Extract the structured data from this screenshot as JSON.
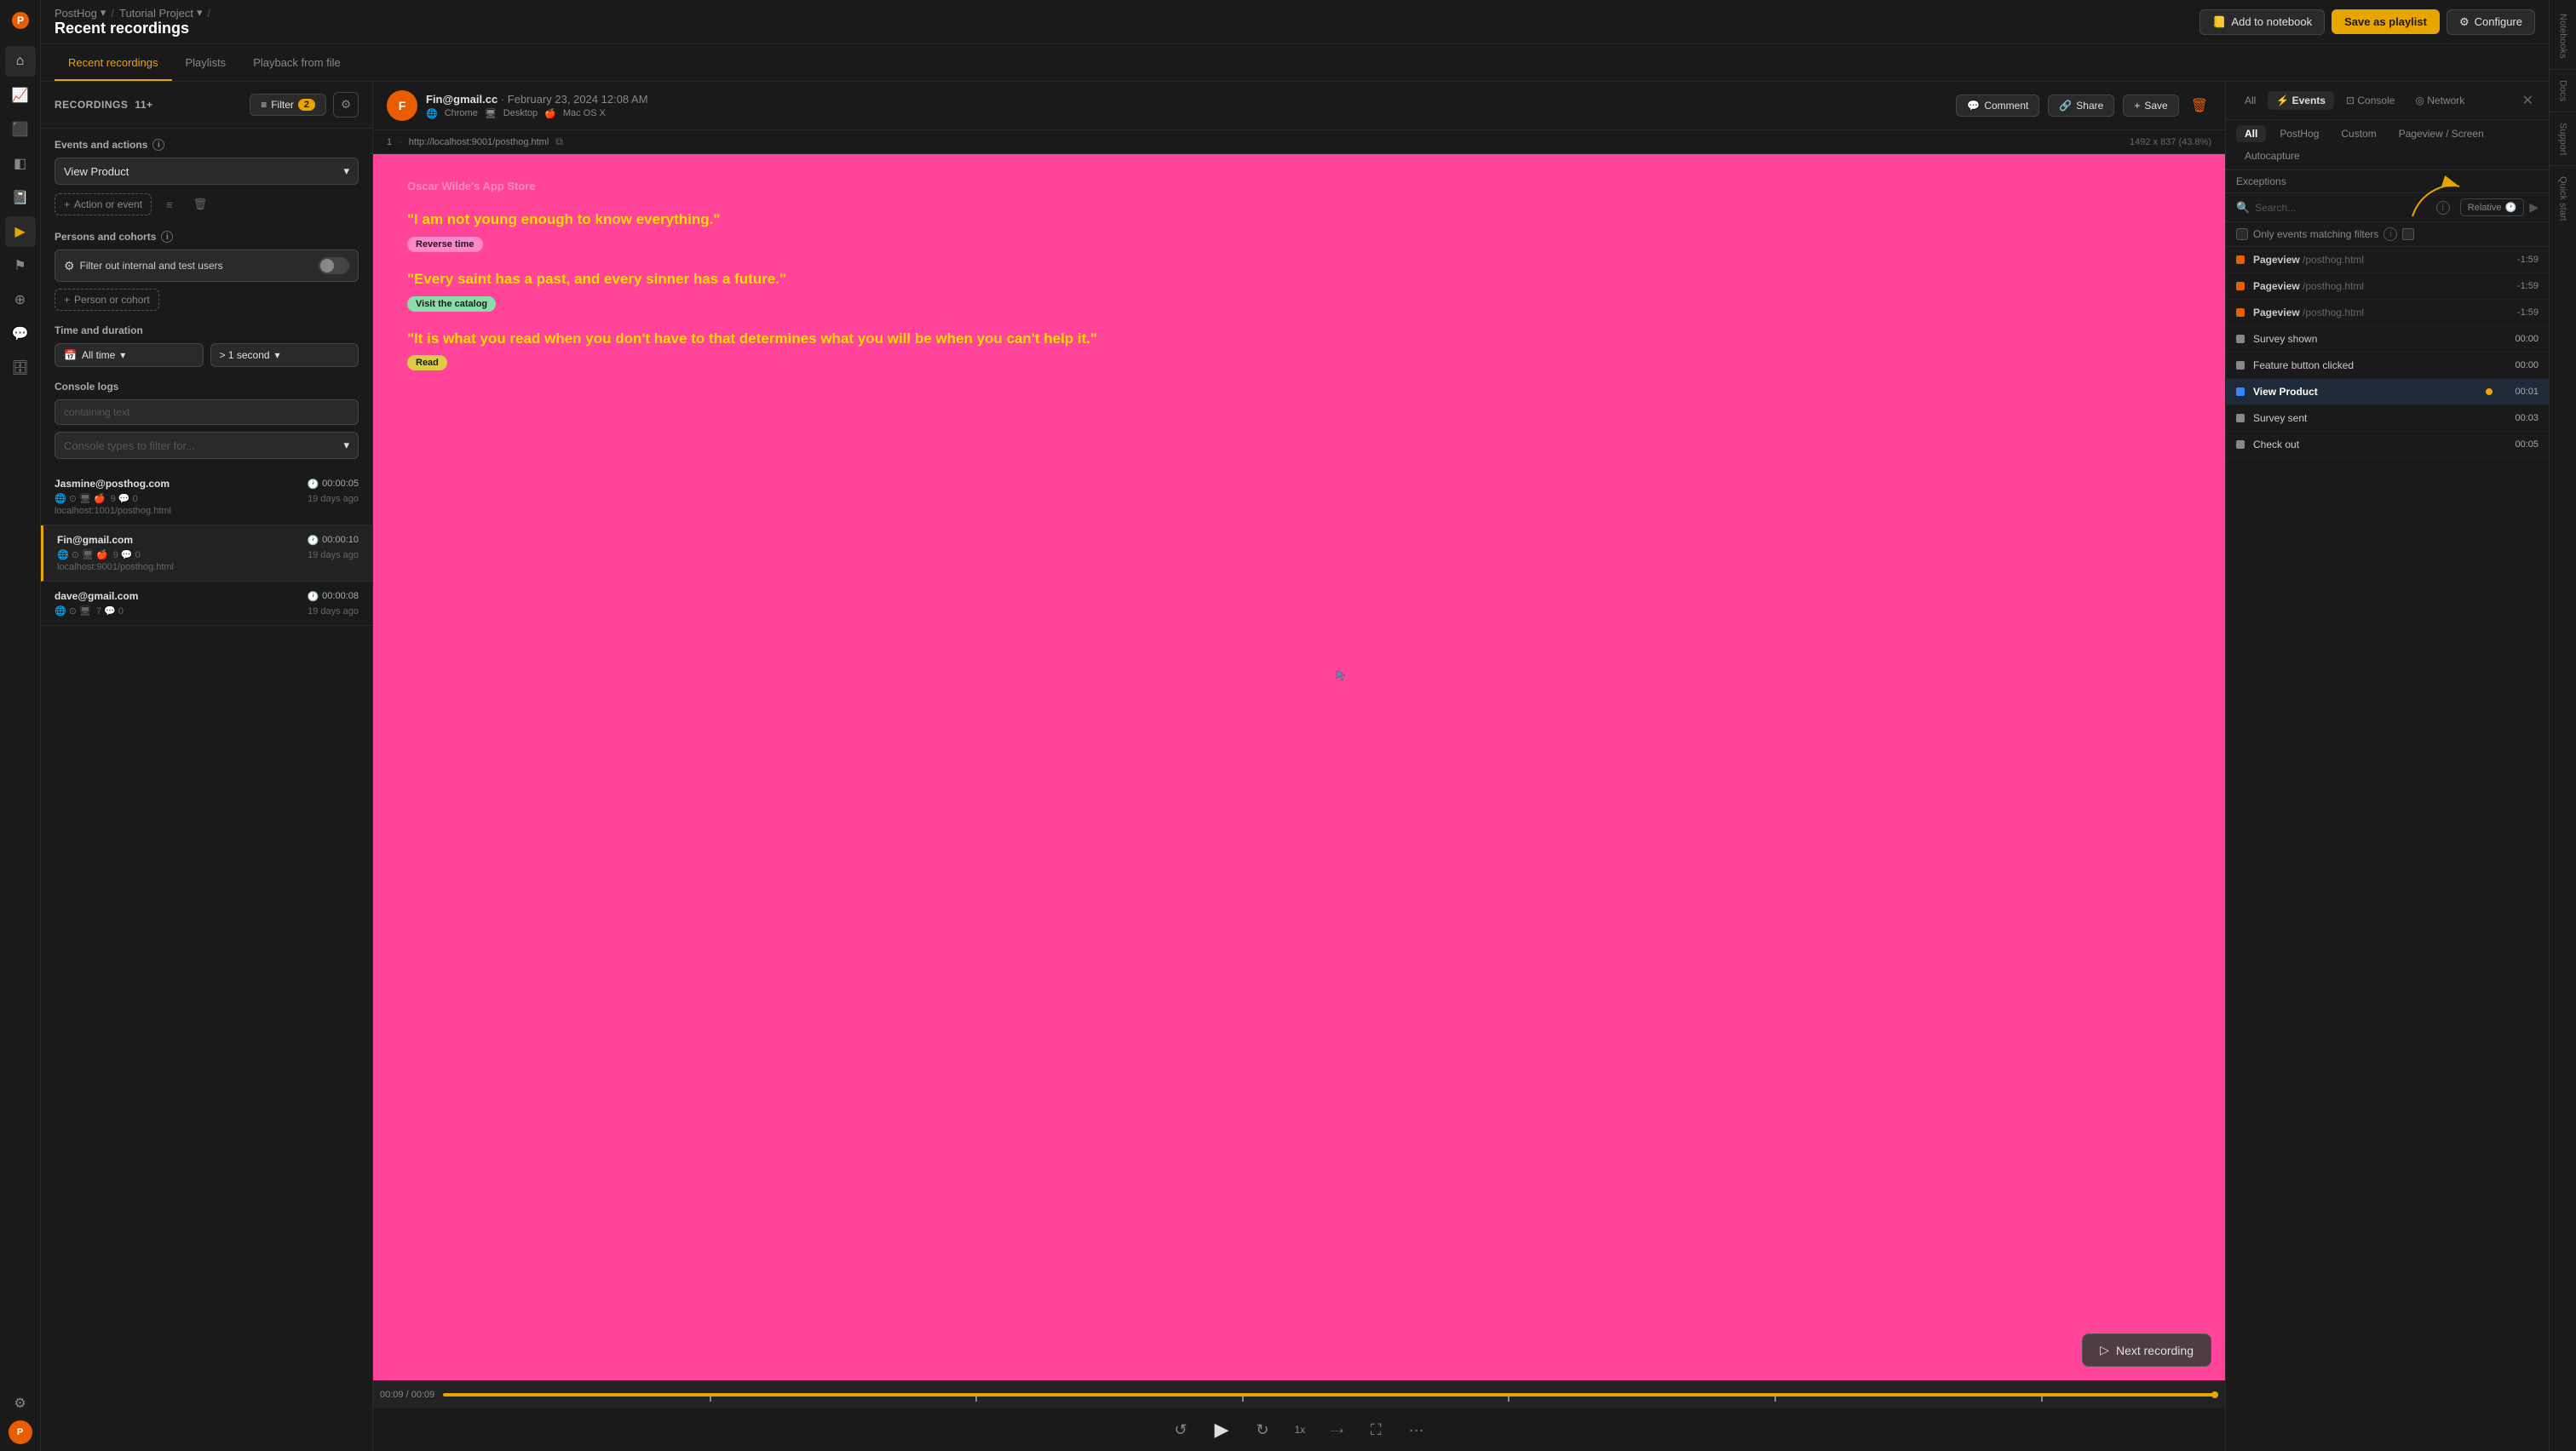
{
  "app": {
    "name": "PostHog",
    "breadcrumb": [
      "PostHog",
      "Tutorial Project"
    ],
    "page_title": "Recent recordings"
  },
  "header": {
    "add_notebook_label": "Add to notebook",
    "save_playlist_label": "Save as playlist",
    "configure_label": "Configure"
  },
  "tabs": [
    {
      "id": "recent",
      "label": "Recent recordings",
      "active": true
    },
    {
      "id": "playlists",
      "label": "Playlists",
      "active": false
    },
    {
      "id": "playback",
      "label": "Playback from file",
      "active": false
    }
  ],
  "filters": {
    "recordings_label": "RECORDINGS",
    "recordings_count": "11+",
    "filter_label": "Filter",
    "filter_badge": "2",
    "sections": {
      "events_actions": {
        "title": "Events and actions",
        "dropdown_value": "View Product",
        "add_label": "Action or event"
      },
      "persons_cohorts": {
        "title": "Persons and cohorts",
        "toggle_text": "Filter out internal and test users",
        "add_label": "Person or cohort"
      },
      "time_duration": {
        "title": "Time and duration",
        "time_value": "All time",
        "duration_value": "> 1 second"
      },
      "console_logs": {
        "title": "Console logs",
        "placeholder": "containing text",
        "types_placeholder": "Console types to filter for..."
      }
    }
  },
  "recordings": [
    {
      "email": "Jasmine@posthog.com",
      "duration": "00:00:05",
      "icons": "🌐 ⊙ 🖥 🍎",
      "meta": "9  0",
      "ago": "19 days ago",
      "url": "localhost:1001/posthog.html",
      "active": false
    },
    {
      "email": "Fin@gmail.com",
      "duration": "00:00:10",
      "icons": "🌐 ⊙ 🖥 🍎",
      "meta": "9  0",
      "ago": "19 days ago",
      "url": "localhost:9001/posthog.html",
      "active": true
    },
    {
      "email": "dave@gmail.com",
      "duration": "00:00:08",
      "icons": "🌐 ⊙ 🖥",
      "meta": "7  0",
      "ago": "19 days ago",
      "url": "",
      "active": false
    }
  ],
  "video": {
    "user_name": "Fin@gmail.cc",
    "date": "February 23, 2024 12:08 AM",
    "browser": "Chrome",
    "device": "Desktop",
    "os": "Mac OS X",
    "url": "http://localhost:9001/posthog.html",
    "resolution": "1492 x 837 (43.8%)",
    "app_store_title": "Oscar Wilde's App Store",
    "quotes": [
      "\"I am not young enough to know everything.\"",
      "\"Every saint has a past, and every sinner has a future.\"",
      "\"It is what you read when you don't have to that determines what you will be when you can't help it.\""
    ],
    "badges": [
      {
        "label": "Reverse time",
        "color": "pink"
      },
      {
        "label": "Visit the catalog",
        "color": "green"
      },
      {
        "label": "Read",
        "color": "yellow"
      }
    ],
    "current_time": "00:09",
    "total_time": "00:09",
    "next_recording": "Next recording",
    "actions": {
      "comment": "Comment",
      "share": "Share",
      "save": "Save"
    }
  },
  "events_panel": {
    "tabs": [
      "All",
      "Events",
      "Console",
      "Network"
    ],
    "filter_tabs": [
      "All",
      "PostHog",
      "Custom",
      "Pageview / Screen",
      "Autocapture"
    ],
    "exceptions_label": "Exceptions",
    "search_placeholder": "Search...",
    "relative_label": "Relative",
    "matching_filter_label": "Only events matching filters",
    "events": [
      {
        "name": "Pageview",
        "path": "/posthog.html",
        "time": "-1:59",
        "type": "pageview",
        "active": false
      },
      {
        "name": "Pageview",
        "path": "/posthog.html",
        "time": "-1:59",
        "type": "pageview",
        "active": false
      },
      {
        "name": "Pageview",
        "path": "/posthog.html",
        "time": "-1:59",
        "type": "pageview",
        "active": false
      },
      {
        "name": "Survey shown",
        "path": "",
        "time": "00:00",
        "type": "custom",
        "active": false
      },
      {
        "name": "Feature button clicked",
        "path": "",
        "time": "00:00",
        "type": "custom",
        "active": false
      },
      {
        "name": "View Product",
        "path": "",
        "time": "00:01",
        "type": "active",
        "active": true
      },
      {
        "name": "Survey sent",
        "path": "",
        "time": "00:03",
        "type": "custom",
        "active": false
      },
      {
        "name": "Check out",
        "path": "",
        "time": "00:05",
        "type": "custom",
        "active": false
      }
    ]
  },
  "right_edge": {
    "notebooks_label": "Notebooks",
    "docs_label": "Docs",
    "support_label": "Support",
    "quick_start_label": "Quick start"
  },
  "sidebar": {
    "icons": [
      {
        "name": "home-icon",
        "symbol": "⌂",
        "active": false
      },
      {
        "name": "activity-icon",
        "symbol": "📊",
        "active": false
      },
      {
        "name": "table-icon",
        "symbol": "⊞",
        "active": false
      },
      {
        "name": "dashboards-icon",
        "symbol": "⬡",
        "active": false
      },
      {
        "name": "notebook-icon",
        "symbol": "📓",
        "active": false
      },
      {
        "name": "replay-icon",
        "symbol": "▶",
        "active": true
      },
      {
        "name": "feature-flags-icon",
        "symbol": "⚑",
        "active": false
      },
      {
        "name": "experiments-icon",
        "symbol": "⊕",
        "active": false
      },
      {
        "name": "surveys-icon",
        "symbol": "💬",
        "active": false
      },
      {
        "name": "data-icon",
        "symbol": "🗄",
        "active": false
      },
      {
        "name": "settings-icon",
        "symbol": "⚙",
        "active": false
      }
    ]
  }
}
